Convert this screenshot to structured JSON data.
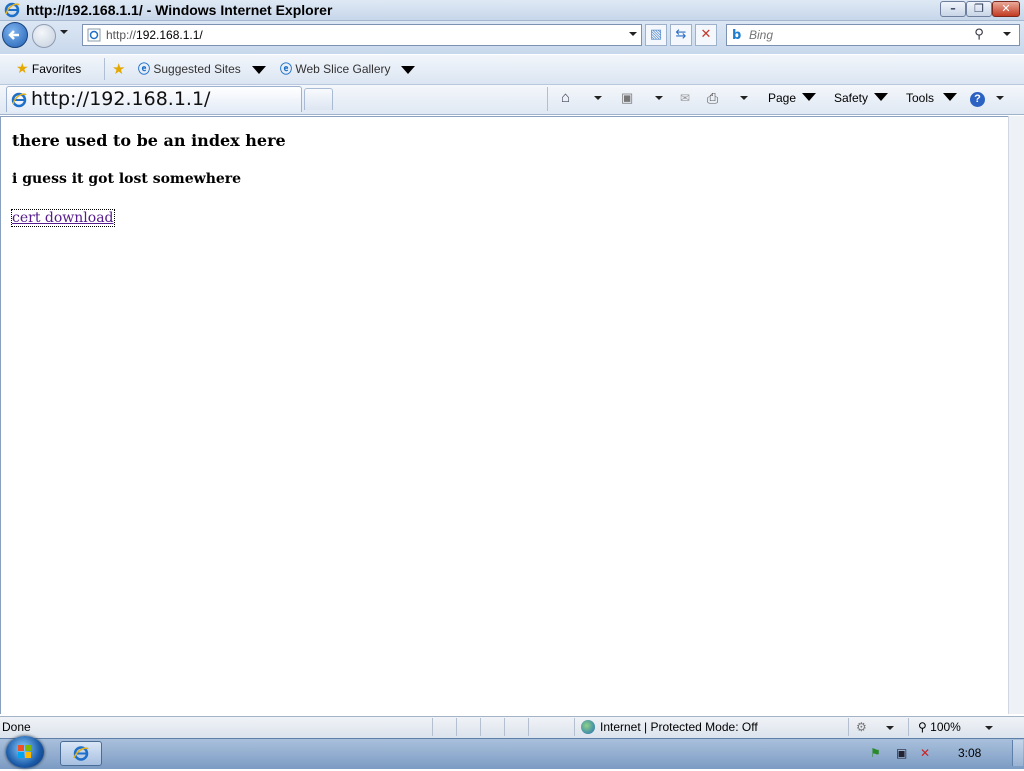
{
  "window": {
    "title": "http://192.168.1.1/ - Windows Internet Explorer"
  },
  "navigation": {
    "address": "http://192.168.1.1/",
    "address_prefix": "http://",
    "address_host": "192.168.1.1/",
    "search_placeholder": "Bing"
  },
  "favorites_bar": {
    "favorites_label": "Favorites",
    "items": [
      {
        "label": "Suggested Sites"
      },
      {
        "label": "Web Slice Gallery"
      }
    ]
  },
  "tab": {
    "label": "http://192.168.1.1/"
  },
  "command_bar": {
    "page_label": "Page",
    "safety_label": "Safety",
    "tools_label": "Tools"
  },
  "page": {
    "heading1": "there used to be an index here",
    "heading2": "i guess it got lost somewhere",
    "link_text": "cert download"
  },
  "status_bar": {
    "status": "Done",
    "zone": "Internet | Protected Mode: Off",
    "zoom": "100%"
  },
  "taskbar": {
    "clock": "3:08"
  },
  "colors": {
    "link_visited": "#551a8b",
    "chrome_blue": "#c8d8ec"
  }
}
